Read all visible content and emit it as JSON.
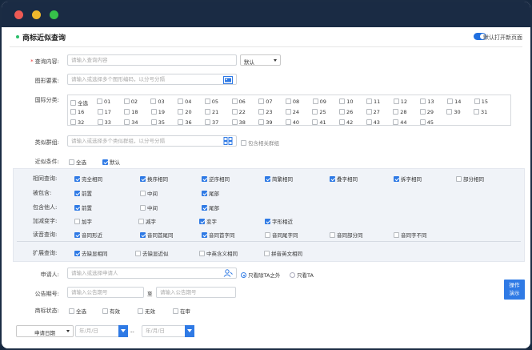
{
  "header": {
    "title": "商标近似查询",
    "toggle_label": "默认打开新页面"
  },
  "query": {
    "label": "查询内容:",
    "placeholder": "请输入查询内容",
    "mode": "默认"
  },
  "figure": {
    "label": "图形要素:",
    "placeholder": "请输入或选择多个图形编码，以分号分隔"
  },
  "intl": {
    "label": "国际分类:",
    "all": "全选",
    "row1": [
      "01",
      "02",
      "03",
      "04",
      "05",
      "06",
      "07",
      "08",
      "09",
      "10",
      "11",
      "12",
      "13",
      "14",
      "15"
    ],
    "row2": [
      "16",
      "17",
      "18",
      "19",
      "20",
      "21",
      "22",
      "23",
      "24",
      "25",
      "26",
      "27",
      "28",
      "29",
      "30",
      "31"
    ],
    "row3": [
      "32",
      "33",
      "34",
      "35",
      "36",
      "37",
      "38",
      "39",
      "40",
      "41",
      "42",
      "43",
      "44",
      "45"
    ]
  },
  "group": {
    "label": "类似群组:",
    "placeholder": "请输入或选择多个类似群组，以分号分隔",
    "include": "包含相关群组"
  },
  "similar": {
    "label": "近似条件:",
    "all": "全选",
    "default": "默认"
  },
  "panel": {
    "r1": {
      "label": "相同查询:",
      "items": [
        "完全相同",
        "换序相同",
        "逆序相同",
        "简繁相同",
        "叠字相同",
        "拆字相同",
        "部分相同"
      ]
    },
    "r2": {
      "label": "被包含:",
      "items": [
        "前置",
        "中间",
        "尾部"
      ]
    },
    "r3": {
      "label": "包含他人:",
      "items": [
        "前置",
        "中间",
        "尾部"
      ]
    },
    "r4": {
      "label": "加减变字:",
      "items": [
        "加字",
        "减字",
        "变字",
        "字形相近"
      ]
    },
    "r5": {
      "label": "读音查询:",
      "items": [
        "音同形近",
        "音同首尾同",
        "音同首字同",
        "音同尾字同",
        "音同部分同",
        "音同字不同"
      ]
    },
    "r6": {
      "label": "扩展查询:",
      "items": [
        "去缺显相同",
        "去缺显近似",
        "中英含义相同",
        "拼音英文相同"
      ]
    }
  },
  "applicant": {
    "label": "申请人:",
    "placeholder": "请输入或选择申请人",
    "opt1": "只看除TA之外",
    "opt2": "只看TA"
  },
  "notice": {
    "label": "公告期号:",
    "placeholder1": "请输入公告期号",
    "to": "至",
    "placeholder2": "请输入公告期号"
  },
  "status": {
    "label": "商标状态:",
    "items": [
      "全选",
      "有效",
      "无效",
      "在审"
    ]
  },
  "date": {
    "type": "申请日期",
    "ph1": "年/月/日",
    "dash": "--",
    "ph2": "年/月/日"
  },
  "demo": {
    "line1": "操作",
    "line2": "演示"
  },
  "colors": {
    "accent": "#2f7ae5",
    "titlebar": "#1a2b44",
    "panel": "#f0f3f8"
  }
}
